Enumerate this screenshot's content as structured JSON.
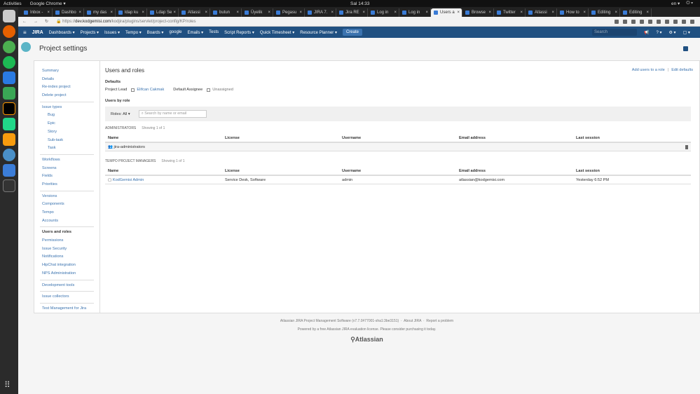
{
  "os": {
    "activities": "Activities",
    "app": "Google Chrome ▾",
    "clock": "Sal 14:33",
    "lang": "en ▾"
  },
  "tabs": [
    "Inbox -",
    "Dashbo",
    "my das",
    "ldap ku",
    "Ldap Se",
    "Atlassi",
    "butun",
    "Üyelik",
    "Pegasu",
    "JIRA 7.",
    "Jira RE",
    "Log in",
    "Log in",
    "Users a",
    "Browse",
    "Twitter",
    "Atlassi",
    "How to",
    "Editing",
    "Editing"
  ],
  "active_tab": 13,
  "address": {
    "scheme": "https://",
    "host": "dev.kodgemisi.com",
    "path": "/kodjira/plugins/servlet/project-config/KP/roles"
  },
  "nav": {
    "logo": "JIRA",
    "items": [
      "Dashboards ▾",
      "Projects ▾",
      "Issues ▾",
      "Tempo ▾",
      "Boards ▾",
      "google",
      "Emails ▾",
      "Tests",
      "Script Reports ▾",
      "Quick Timesheet ▾",
      "Resource Planner ▾"
    ],
    "create": "Create",
    "search_placeholder": "Search"
  },
  "page": {
    "title": "Project settings"
  },
  "sidebar": {
    "groups": [
      [
        {
          "label": "Summary"
        },
        {
          "label": "Details"
        },
        {
          "label": "Re-index project"
        },
        {
          "label": "Delete project"
        }
      ],
      [
        {
          "label": "Issue types"
        },
        {
          "label": "Bug",
          "sub": true
        },
        {
          "label": "Epic",
          "sub": true
        },
        {
          "label": "Story",
          "sub": true
        },
        {
          "label": "Sub-task",
          "sub": true
        },
        {
          "label": "Task",
          "sub": true
        }
      ],
      [
        {
          "label": "Workflows"
        },
        {
          "label": "Screens"
        },
        {
          "label": "Fields"
        },
        {
          "label": "Priorities"
        }
      ],
      [
        {
          "label": "Versions"
        },
        {
          "label": "Components"
        },
        {
          "label": "Tempo"
        },
        {
          "label": "Accounts"
        }
      ],
      [
        {
          "label": "Users and roles",
          "current": true
        },
        {
          "label": "Permissions"
        },
        {
          "label": "Issue Security"
        },
        {
          "label": "Notifications"
        },
        {
          "label": "HipChat integration"
        },
        {
          "label": "NPS Administration"
        }
      ],
      [
        {
          "label": "Development tools"
        }
      ],
      [
        {
          "label": "Issue collectors"
        }
      ],
      [
        {
          "label": "Test Management for Jira"
        }
      ]
    ]
  },
  "main": {
    "title": "Users and roles",
    "add_users": "Add users to a role",
    "sep": "|",
    "edit_defaults": "Edit defaults",
    "defaults_label": "Defaults",
    "project_lead_label": "Project Lead",
    "project_lead": "Elifcan Cakmak",
    "default_assignee_label": "Default Assignee",
    "default_assignee": "Unassigned",
    "users_by_role": "Users by role",
    "roles_filter": "Roles: All ▾",
    "search_placeholder": "Search by name or email",
    "columns": [
      "Name",
      "License",
      "Username",
      "Email address",
      "Last session"
    ],
    "sections": [
      {
        "name": "ADMINISTRATORS",
        "count": "Showing 1 of 1",
        "rows": [
          {
            "name": "jira-administrators",
            "license": "",
            "username": "",
            "email": "",
            "last": "",
            "group": true
          }
        ]
      },
      {
        "name": "TEMPO PROJECT MANAGERS",
        "count": "Showing 1 of 1",
        "rows": [
          {
            "name": "KodGemisi Admin",
            "license": "Service Desk, Software",
            "username": "admin",
            "email": "atlassian@kodgemisi.com",
            "last": "Yesterday 6:52 PM",
            "group": false
          }
        ]
      }
    ]
  },
  "footer": {
    "version": "Atlassian JIRA Project Management Software (v7.7.0#77001-sha1:3be3151)",
    "about": "About JIRA",
    "report": "Report a problem",
    "dot": "·",
    "powered": "Powered by a free Atlassian JIRA evaluation license. Please consider purchasing it today.",
    "logo": "Atlassian"
  }
}
